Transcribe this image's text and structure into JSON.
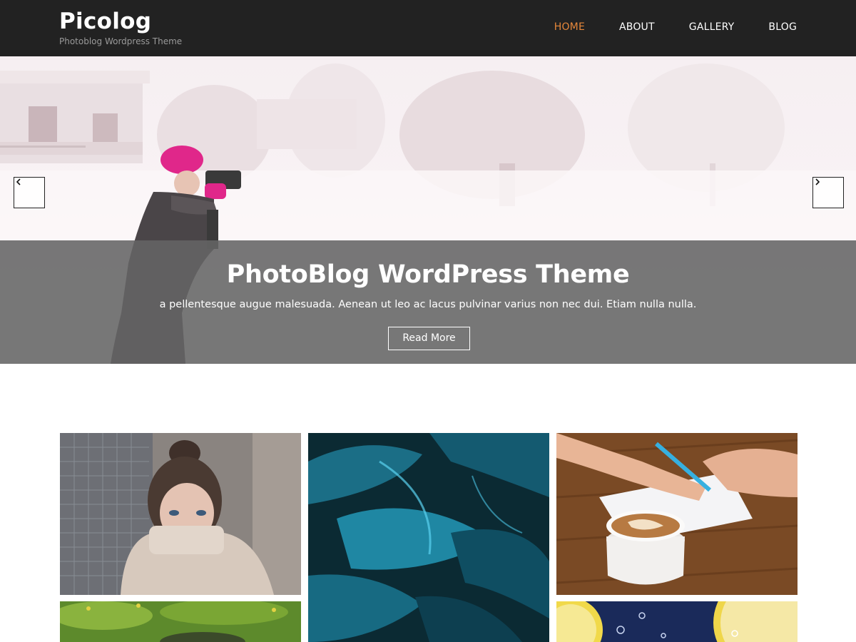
{
  "header": {
    "site_title": "Picolog",
    "tagline": "Photoblog Wordpress Theme",
    "nav": [
      "HOME",
      "ABOUT",
      "GALLERY",
      "BLOG"
    ],
    "active_nav": "HOME",
    "colors": {
      "background": "#222222",
      "active": "#e6873a",
      "text": "#ffffff"
    }
  },
  "hero": {
    "title": "PhotoBlog WordPress Theme",
    "text": "a pellentesque augue malesuada. Aenean ut leo ac lacus pulvinar varius non nec dui. Etiam nulla nulla.",
    "button_label": "Read More",
    "prev_icon": "chevron-left-icon",
    "next_icon": "chevron-right-icon"
  },
  "gallery": {
    "images": [
      "woman-knit-sweater-photo",
      "blue-plant-leaves-photo",
      "coffee-notebook-photo",
      "green-grass-photo",
      "lemon-slices-water-photo"
    ]
  }
}
